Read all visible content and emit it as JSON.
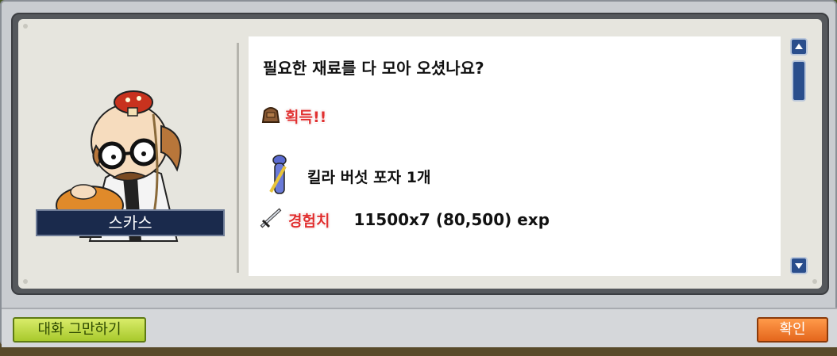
{
  "dialog": {
    "npc_name": "스카스",
    "question": "필요한 재료를 다 모아 오셨나요?",
    "acquire_label": "획득!!",
    "item_text": "킬라 버섯 포자 1개",
    "exp_label": "경험치",
    "exp_text": "11500x7 (80,500) exp"
  },
  "buttons": {
    "end_chat": "대화 그만하기",
    "confirm": "확인"
  },
  "colors": {
    "accent_red": "#e03030",
    "name_plate": "#1a2a4c",
    "end_button": "#a8c92c",
    "confirm_button": "#e4661c"
  },
  "icons": [
    "npc-portrait",
    "bag-icon",
    "potion-icon",
    "sword-icon",
    "scroll-up-icon",
    "scroll-down-icon"
  ]
}
